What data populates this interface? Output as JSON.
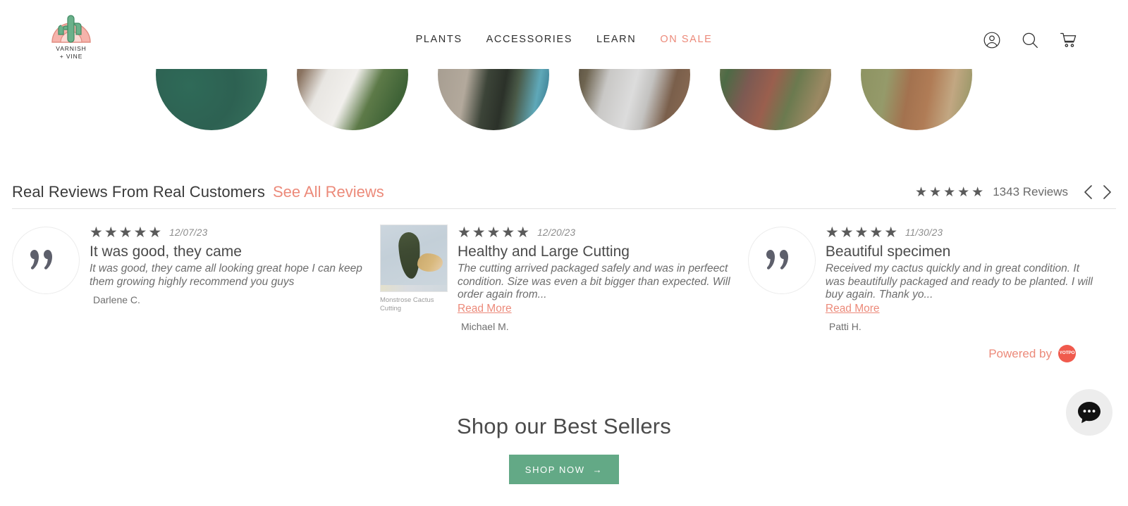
{
  "header": {
    "logo": {
      "name": "varnish-vine-logo",
      "text": "VARNISH\n+ VINE"
    },
    "nav": [
      {
        "label": "PLANTS",
        "accent": false
      },
      {
        "label": "ACCESSORIES",
        "accent": false
      },
      {
        "label": "LEARN",
        "accent": false
      },
      {
        "label": "ON SALE",
        "accent": true
      }
    ],
    "icons": [
      {
        "name": "account-icon",
        "label": "Account"
      },
      {
        "name": "search-icon",
        "label": "Search"
      },
      {
        "name": "cart-icon",
        "label": "Cart"
      }
    ]
  },
  "hero_circles": [
    {
      "name": "plant-photo-1"
    },
    {
      "name": "plant-photo-2"
    },
    {
      "name": "plant-photo-3"
    },
    {
      "name": "plant-photo-4"
    },
    {
      "name": "plant-photo-5"
    },
    {
      "name": "plant-photo-6"
    }
  ],
  "reviews_section": {
    "title": "Real Reviews From Real Customers",
    "see_all_label": "See All Reviews",
    "rating_stars": 5,
    "star_glyph": "★",
    "review_count_label": "1343 Reviews",
    "prev_label": "Previous",
    "next_label": "Next",
    "powered_by_label": "Powered by",
    "powered_by_brand": "YOTPO",
    "reviews": [
      {
        "avatar_type": "quote",
        "stars": 5,
        "date": "12/07/23",
        "title": "It was good, they came",
        "text": "It was good, they came all looking great hope I can keep them growing highly recommend you guys",
        "read_more": "",
        "author": "Darlene C.",
        "product_caption": ""
      },
      {
        "avatar_type": "product",
        "stars": 5,
        "date": "12/20/23",
        "title": "Healthy and Large Cutting",
        "text": "The cutting arrived packaged safely and was in perfeect condition. Size was even a bit bigger than expected. Will order again from...",
        "read_more": "Read More",
        "author": "Michael M.",
        "product_caption": "Monstrose Cactus\nCutting"
      },
      {
        "avatar_type": "quote",
        "stars": 5,
        "date": "11/30/23",
        "title": "Beautiful specimen",
        "text": "Received my cactus quickly and in great condition. It was beautifully packaged and ready to be planted. I will buy again. Thank yo...",
        "read_more": "Read More",
        "author": "Patti H.",
        "product_caption": ""
      }
    ]
  },
  "best_sellers": {
    "title": "Shop our Best Sellers",
    "cta_label": "SHOP NOW",
    "cta_arrow": "→"
  },
  "chat": {
    "name": "chat-widget",
    "label": "Open chat"
  },
  "colors": {
    "accent_salmon": "#ec8a7a",
    "button_green": "#63a986",
    "yotpo_red": "#f05a4d",
    "text_dark": "#3a3a3a"
  }
}
